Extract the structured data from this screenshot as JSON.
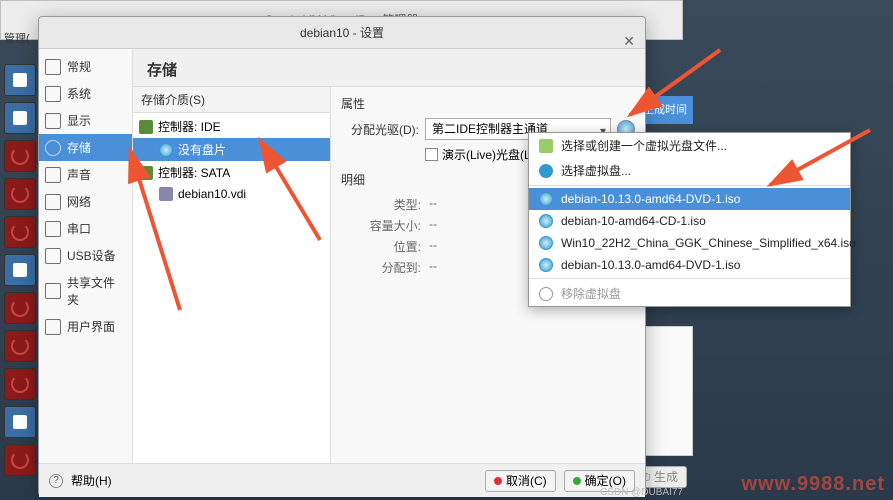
{
  "parent_window": {
    "title": "Oracle VM VirtualBox 管理器",
    "manager_label": "管理("
  },
  "settings": {
    "title": "debian10 - 设置",
    "sidebar": [
      {
        "label": "常规"
      },
      {
        "label": "系统"
      },
      {
        "label": "显示"
      },
      {
        "label": "存储"
      },
      {
        "label": "声音"
      },
      {
        "label": "网络"
      },
      {
        "label": "串口"
      },
      {
        "label": "USB设备"
      },
      {
        "label": "共享文件夹"
      },
      {
        "label": "用户界面"
      }
    ],
    "active_sidebar_index": 3,
    "page_title": "存储",
    "tree_header": "存储介质(S)",
    "tree": {
      "ctrl_ide": "控制器: IDE",
      "empty_disc": "没有盘片",
      "ctrl_sata": "控制器: SATA",
      "vdi": "debian10.vdi"
    },
    "props": {
      "header": "属性",
      "drive_label": "分配光驱(D):",
      "drive_value": "第二IDE控制器主通道",
      "live_cd_label": "演示(Live)光盘(L)",
      "detail_header": "明细",
      "details": {
        "type_k": "类型:",
        "type_v": "--",
        "size_k": "容量大小:",
        "size_v": "--",
        "loc_k": "位置:",
        "loc_v": "--",
        "assign_k": "分配到:",
        "assign_v": "--"
      }
    },
    "footer": {
      "help": "帮助(H)",
      "cancel": "取消(C)",
      "ok": "确定(O)"
    }
  },
  "menu": {
    "choose_create": "选择或创建一个虚拟光盘文件...",
    "choose_virtual": "选择虚拟盘...",
    "items": [
      "debian-10.13.0-amd64-DVD-1.iso",
      "debian-10-amd64-CD-1.iso",
      "Win10_22H2_China_GGK_Chinese_Simplified_x64.iso",
      "debian-10.13.0-amd64-DVD-1.iso"
    ],
    "selected_index": 0,
    "remove": "移除虚拟盘"
  },
  "right": {
    "col_header": "生成时间",
    "new_btn": "生成"
  },
  "watermark": "www.9988.net",
  "csdn": "CSDN @DUBAI77"
}
